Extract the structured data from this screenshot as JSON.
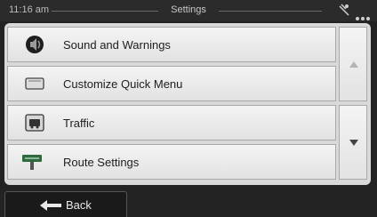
{
  "status_bar": {
    "time": "11:16 am",
    "title": "Settings",
    "gps_icon": "satellite-icon",
    "menu_icon": "more-dots-icon"
  },
  "menu": {
    "items": [
      {
        "label": "Sound and Warnings",
        "icon": "speaker-icon"
      },
      {
        "label": "Customize Quick Menu",
        "icon": "quick-menu-icon"
      },
      {
        "label": "Traffic",
        "icon": "traffic-icon"
      },
      {
        "label": "Route Settings",
        "icon": "route-settings-icon"
      }
    ]
  },
  "scroll": {
    "up_icon": "scroll-up-icon",
    "down_icon": "scroll-down-icon"
  },
  "footer": {
    "back_label": "Back",
    "back_icon": "back-arrow-icon"
  },
  "colors": {
    "background": "#232323",
    "panel": "#d9d9d9",
    "item": "#eeeeee",
    "text": "#202020"
  }
}
